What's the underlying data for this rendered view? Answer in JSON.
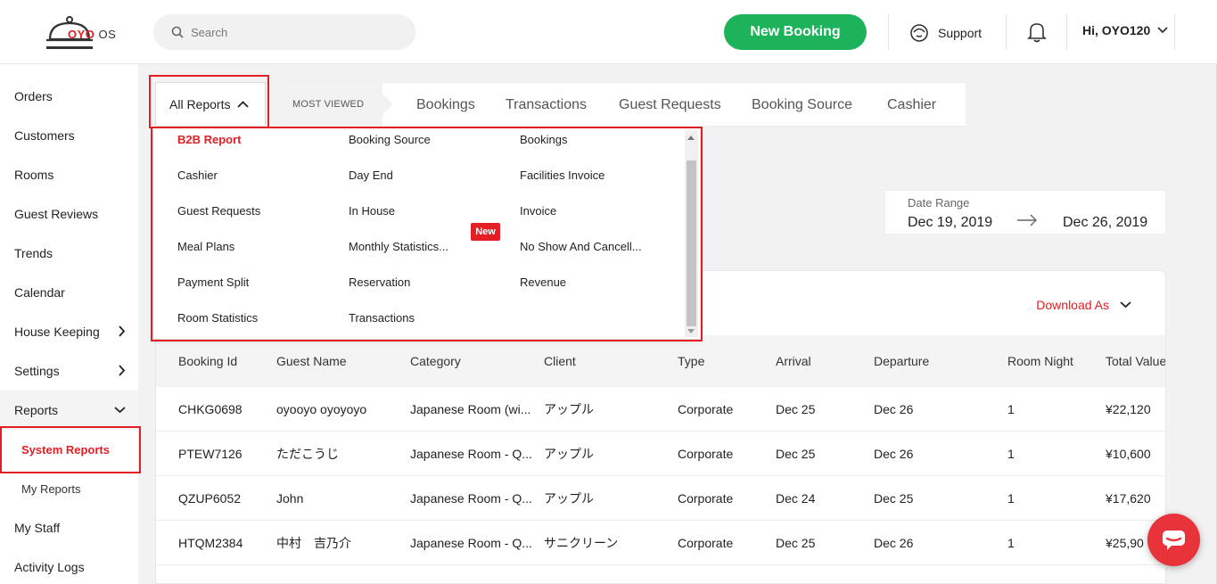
{
  "header": {
    "logo_brand": "OYO",
    "logo_suffix": "OS",
    "search_placeholder": "Search",
    "new_booking": "New Booking",
    "support": "Support",
    "user": "Hi, OYO120"
  },
  "sidebar": {
    "items": [
      {
        "label": "Orders"
      },
      {
        "label": "Customers"
      },
      {
        "label": "Rooms"
      },
      {
        "label": "Guest Reviews"
      },
      {
        "label": "Trends"
      },
      {
        "label": "Calendar"
      },
      {
        "label": "House Keeping"
      },
      {
        "label": "Settings"
      },
      {
        "label": "Reports"
      },
      {
        "label": "System Reports"
      },
      {
        "label": "My Reports"
      },
      {
        "label": "My Staff"
      },
      {
        "label": "Activity Logs"
      }
    ]
  },
  "reports_bar": {
    "all_reports": "All Reports",
    "most_viewed": "MOST VIEWED",
    "tabs": [
      "Bookings",
      "Transactions",
      "Guest Requests",
      "Booking Source",
      "Cashier"
    ]
  },
  "dropdown": {
    "items": [
      "B2B Report",
      "Booking Source",
      "Bookings",
      "Cashier",
      "Day End",
      "Facilities Invoice",
      "Guest Requests",
      "In House",
      "Invoice",
      "Meal Plans",
      "Monthly Statistics...",
      "No Show And Cancell...",
      "Payment Split",
      "Reservation",
      "Revenue",
      "Room Statistics",
      "Transactions"
    ],
    "new_badge": "New"
  },
  "date_range": {
    "label": "Date Range",
    "from": "Dec 19, 2019",
    "to": "Dec 26, 2019"
  },
  "table": {
    "download_as": "Download As",
    "columns": [
      "Booking Id",
      "Guest Name",
      "Category",
      "Client",
      "Type",
      "Arrival",
      "Departure",
      "Room Night",
      "Total Value"
    ],
    "rows": [
      [
        "CHKG0698",
        "oyooyo oyoyoyo",
        "Japanese Room (wi...",
        "アップル",
        "Corporate",
        "Dec 25",
        "Dec 26",
        "1",
        "¥22,120"
      ],
      [
        "PTEW7126",
        "ただこうじ",
        "Japanese Room - Q...",
        "アップル",
        "Corporate",
        "Dec 25",
        "Dec 26",
        "1",
        "¥10,600"
      ],
      [
        "QZUP6052",
        "John",
        "Japanese Room - Q...",
        "アップル",
        "Corporate",
        "Dec 24",
        "Dec 25",
        "1",
        "¥17,620"
      ],
      [
        "HTQM2384",
        "中村　吉乃介",
        "Japanese Room - Q...",
        "サニクリーン",
        "Corporate",
        "Dec 25",
        "Dec 26",
        "1",
        "¥25,90"
      ]
    ]
  },
  "colors": {
    "brand_red": "#e31e24",
    "green": "#1db35b"
  }
}
